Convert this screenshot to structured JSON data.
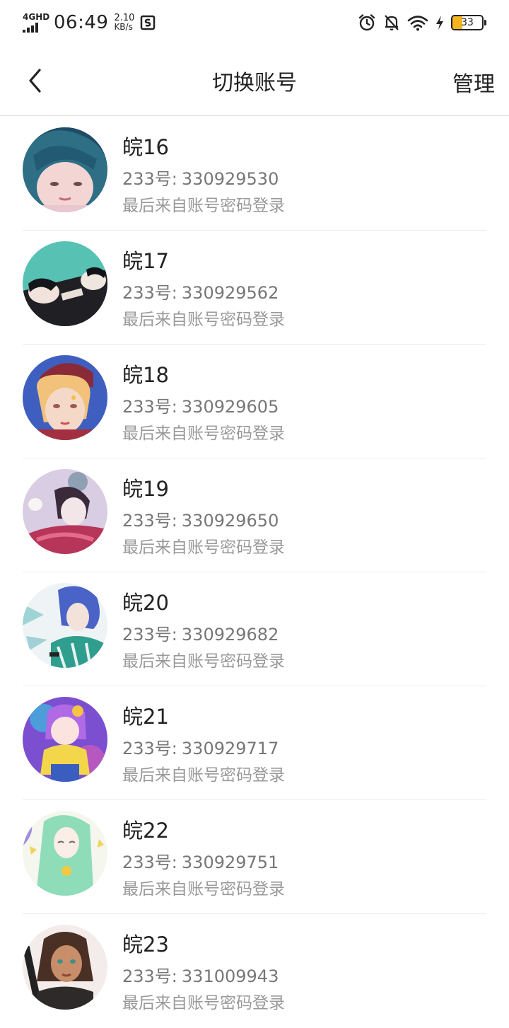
{
  "status_bar": {
    "network": "4GHD",
    "time": "06:49",
    "speed_value": "2.10",
    "speed_unit": "KB/s",
    "battery_percent": "33",
    "battery_level": 0.33,
    "icons": [
      "signal-icon",
      "app-notification-icon",
      "alarm-icon",
      "mute-notification-icon",
      "wifi-icon",
      "charging-icon",
      "battery-icon"
    ]
  },
  "nav": {
    "back_icon": "back-arrow-icon",
    "title": "切换账号",
    "manage_label": "管理"
  },
  "accounts": [
    {
      "name": "皖16",
      "id_label": "233号:",
      "id_value": "330929530",
      "login_note": "最后来自账号密码登录"
    },
    {
      "name": "皖17",
      "id_label": "233号:",
      "id_value": "330929562",
      "login_note": "最后来自账号密码登录"
    },
    {
      "name": "皖18",
      "id_label": "233号:",
      "id_value": "330929605",
      "login_note": "最后来自账号密码登录"
    },
    {
      "name": "皖19",
      "id_label": "233号:",
      "id_value": "330929650",
      "login_note": "最后来自账号密码登录"
    },
    {
      "name": "皖20",
      "id_label": "233号:",
      "id_value": "330929682",
      "login_note": "最后来自账号密码登录"
    },
    {
      "name": "皖21",
      "id_label": "233号:",
      "id_value": "330929717",
      "login_note": "最后来自账号密码登录"
    },
    {
      "name": "皖22",
      "id_label": "233号:",
      "id_value": "330929751",
      "login_note": "最后来自账号密码登录"
    },
    {
      "name": "皖23",
      "id_label": "233号:",
      "id_value": "331009943",
      "login_note": "最后来自账号密码登录"
    }
  ]
}
